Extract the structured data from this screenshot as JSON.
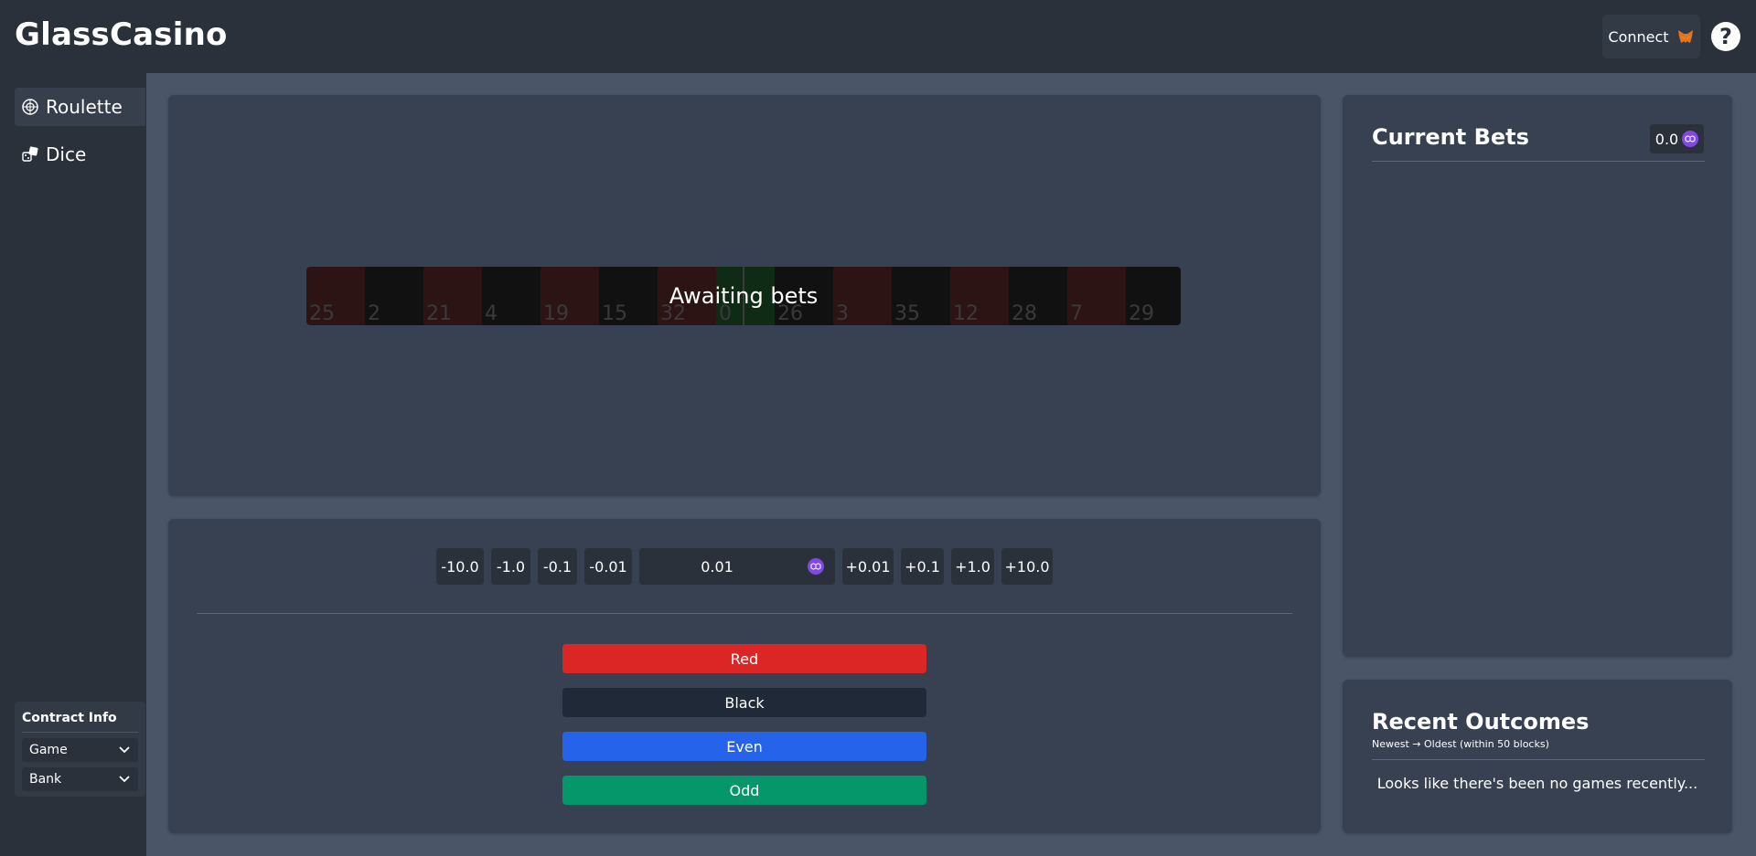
{
  "header": {
    "logo": "GlassCasino",
    "connect_label": "Connect",
    "help_label": "?"
  },
  "sidebar": {
    "items": [
      {
        "label": "Roulette",
        "icon": "roulette-icon",
        "active": true
      },
      {
        "label": "Dice",
        "icon": "dice-icon",
        "active": false
      }
    ],
    "contract_info": {
      "title": "Contract Info",
      "selects": [
        {
          "label": "Game"
        },
        {
          "label": "Bank"
        }
      ]
    }
  },
  "wheel": {
    "status": "Awaiting bets",
    "numbers": [
      "25",
      "2",
      "21",
      "4",
      "19",
      "15",
      "32",
      "0",
      "",
      "26",
      "3",
      "35",
      "12",
      "28",
      "7",
      "29"
    ],
    "colors": [
      "red",
      "black",
      "red",
      "black",
      "red",
      "black",
      "red",
      "green",
      "green",
      "black",
      "red",
      "black",
      "red",
      "black",
      "red",
      "black"
    ]
  },
  "bet_amount": {
    "decrements": [
      "-10.0",
      "-1.0",
      "-0.1",
      "-0.01"
    ],
    "value": "0.01",
    "increments": [
      "+0.01",
      "+0.1",
      "+1.0",
      "+10.0"
    ]
  },
  "bets": {
    "red": "Red",
    "black": "Black",
    "even": "Even",
    "odd": "Odd"
  },
  "current_bets": {
    "title": "Current Bets",
    "total": "0.0"
  },
  "recent_outcomes": {
    "title": "Recent Outcomes",
    "subtitle": "Newest → Oldest (within 50 blocks)",
    "empty_message": "Looks like there's been no games recently..."
  },
  "colors": {
    "red": "#dc2626",
    "black": "#1f2937",
    "even": "#2563eb",
    "odd": "#059669",
    "matic": "#8247e5"
  }
}
